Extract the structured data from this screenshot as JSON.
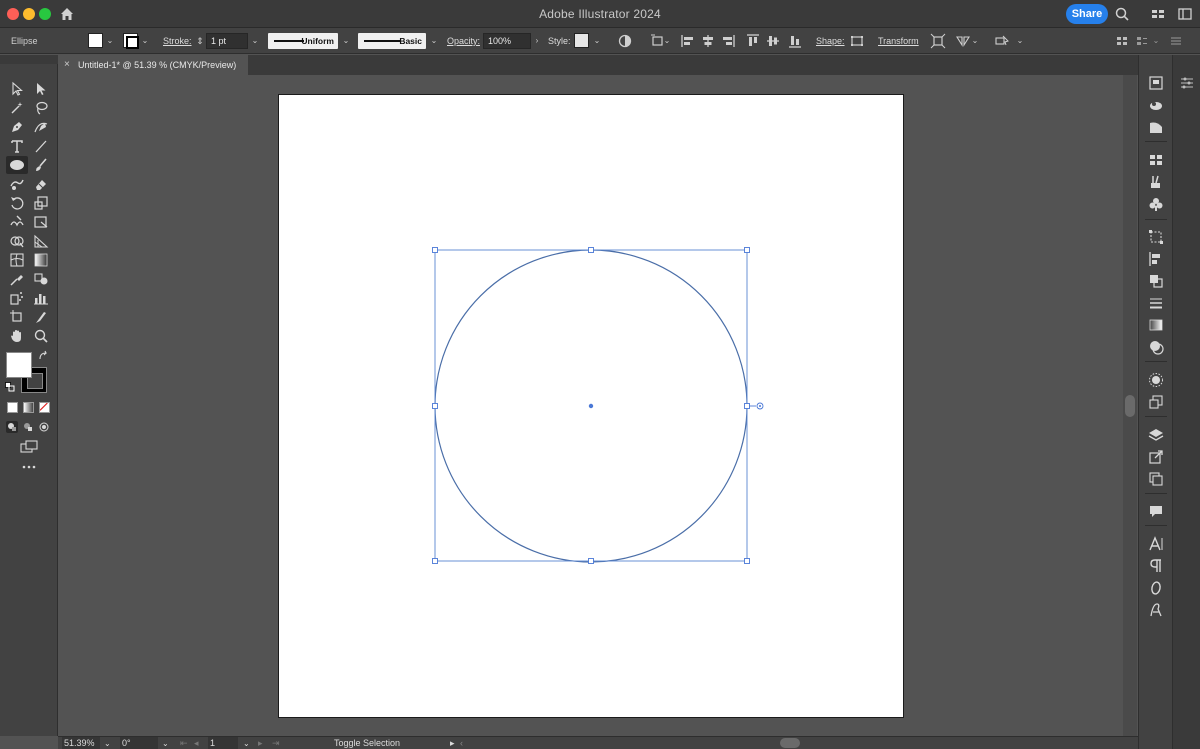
{
  "window": {
    "title": "Adobe Illustrator 2024",
    "share_label": "Share"
  },
  "controlbar": {
    "object_type": "Ellipse",
    "stroke_label": "Stroke:",
    "stroke_weight": "1 pt",
    "variable_width_profile": "Uniform",
    "brush_definition": "Basic",
    "opacity_label": "Opacity:",
    "opacity_value": "100%",
    "style_label": "Style:",
    "shape_label": "Shape:",
    "transform_label": "Transform"
  },
  "document_tab": {
    "close_glyph": "×",
    "title": "Untitled-1* @ 51.39 % (CMYK/Preview)"
  },
  "status": {
    "zoom": "51.39%",
    "rotation": "0°",
    "artboard_number": "1",
    "status_text": "Toggle Selection"
  },
  "colors": {
    "selection_blue": "#4a78d6",
    "share_blue": "#2680eb",
    "ui_dark": "#424242",
    "canvas_gray": "#535353"
  },
  "icons": {
    "left_tools": [
      "selection-tool-icon",
      "direct-selection-tool-icon",
      "magic-wand-tool-icon",
      "lasso-tool-icon",
      "pen-tool-icon",
      "curvature-tool-icon",
      "type-tool-icon",
      "line-segment-tool-icon",
      "ellipse-tool-icon",
      "paintbrush-tool-icon",
      "shaper-tool-icon",
      "eraser-tool-icon",
      "rotate-tool-icon",
      "scale-tool-icon",
      "warp-tool-icon",
      "free-transform-tool-icon",
      "shape-builder-tool-icon",
      "perspective-grid-tool-icon",
      "mesh-tool-icon",
      "gradient-tool-icon",
      "eyedropper-tool-icon",
      "blend-tool-icon",
      "symbol-sprayer-tool-icon",
      "column-graph-tool-icon",
      "artboard-tool-icon",
      "slice-tool-icon",
      "hand-tool-icon",
      "zoom-tool-icon"
    ],
    "right_panels": [
      "properties-icon",
      "libraries-icon",
      "color-guide-icon",
      "swatches-icon",
      "brushes-icon",
      "symbols-icon",
      "transform-icon",
      "align-icon",
      "pathfinder-icon",
      "stroke-icon",
      "gradient-icon",
      "transparency-icon",
      "appearance-icon",
      "graphic-styles-icon",
      "layers-icon",
      "asset-export-icon",
      "artboards-icon",
      "comments-icon",
      "character-icon",
      "paragraph-icon",
      "opentype-icon",
      "glyphs-icon"
    ]
  }
}
